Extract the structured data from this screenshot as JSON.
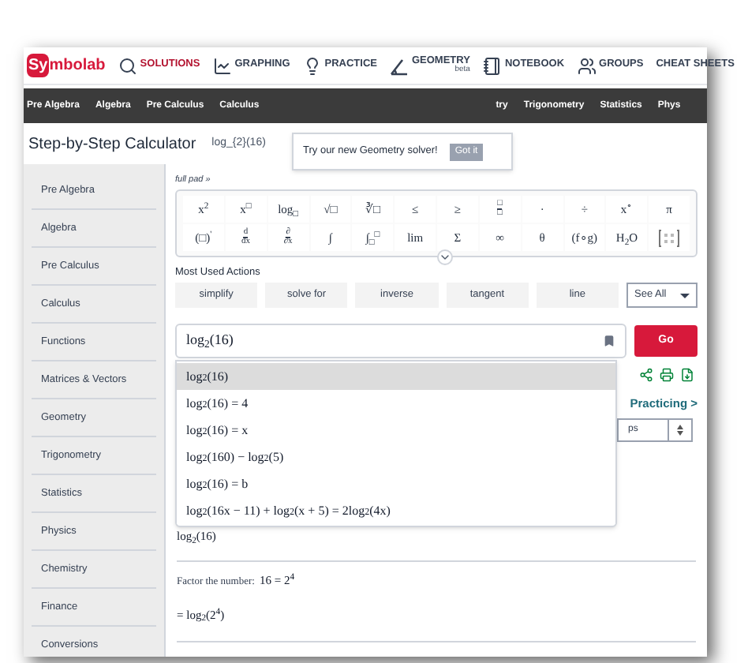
{
  "logo": {
    "accent": "Sy",
    "rest": "mbolab"
  },
  "nav": [
    {
      "label": "SOLUTIONS",
      "selected": true
    },
    {
      "label": "GRAPHING",
      "selected": false
    },
    {
      "label": "PRACTICE",
      "selected": false
    },
    {
      "label": "GEOMETRY",
      "sub": "beta",
      "selected": false
    },
    {
      "label": "NOTEBOOK",
      "selected": false
    },
    {
      "label": "GROUPS",
      "selected": false
    },
    {
      "label": "CHEAT SHEETS",
      "selected": false
    }
  ],
  "categories_left": [
    "Pre Algebra",
    "Algebra",
    "Pre Calculus",
    "Calculus"
  ],
  "categories_right": [
    "try",
    "Trigonometry",
    "Statistics",
    "Phys"
  ],
  "tooltip": {
    "text": "Try our new Geometry solver!",
    "button": "Got it"
  },
  "page_title": "Step-by-Step Calculator",
  "query": "log_{2}(16)",
  "sidebar": [
    "Pre Algebra",
    "Algebra",
    "Pre Calculus",
    "Calculus",
    "Functions",
    "Matrices & Vectors",
    "Geometry",
    "Trigonometry",
    "Statistics",
    "Physics",
    "Chemistry",
    "Finance",
    "Conversions"
  ],
  "pad_toggle": "full pad »",
  "keypad": [
    [
      {
        "kind": "text",
        "t": "x$^{2}$"
      },
      {
        "kind": "text",
        "t": "x$^{□}$"
      },
      {
        "kind": "text",
        "t": "log$_{□}$"
      },
      {
        "kind": "text",
        "t": "√□"
      },
      {
        "kind": "text",
        "t": "∛□"
      },
      {
        "kind": "text",
        "t": "≤"
      },
      {
        "kind": "text",
        "t": "≥"
      },
      {
        "kind": "fraction",
        "top": "□",
        "bottom": "□"
      },
      {
        "kind": "text",
        "t": "·"
      },
      {
        "kind": "text",
        "t": "÷"
      },
      {
        "kind": "text",
        "t": "x$^{∘}$"
      },
      {
        "kind": "text",
        "t": "π"
      }
    ],
    [
      {
        "kind": "text",
        "t": "(□)$^{'}$"
      },
      {
        "kind": "fraction",
        "top": "d",
        "bottom": "dx"
      },
      {
        "kind": "fraction",
        "top": "∂",
        "bottom": "∂x"
      },
      {
        "kind": "text",
        "t": "∫"
      },
      {
        "kind": "text",
        "t": "∫$_{□}$$^{□}$"
      },
      {
        "kind": "text",
        "t": "lim"
      },
      {
        "kind": "text",
        "t": "Σ"
      },
      {
        "kind": "text",
        "t": "∞"
      },
      {
        "kind": "text",
        "t": "θ"
      },
      {
        "kind": "text",
        "t": "(f∘g)"
      },
      {
        "kind": "text",
        "t": "H$_{2}$O"
      },
      {
        "kind": "matrix"
      }
    ]
  ],
  "actions_title": "Most Used Actions",
  "actions": [
    "simplify",
    "solve for",
    "inverse",
    "tangent",
    "line"
  ],
  "see_all": "See All",
  "input": {
    "value": "log$_{2}$(16)"
  },
  "go": "Go",
  "suggestions": [
    {
      "text": "log$_{2}$(16)",
      "selected": true
    },
    {
      "text": "log$_{2}$(16) = 4",
      "selected": false
    },
    {
      "text": "log$_{2}$(16) = x",
      "selected": false
    },
    {
      "text": "log$_{2}$(160) − log$_{2}$(5)",
      "selected": false
    },
    {
      "text": "log$_{2}$(16) = b",
      "selected": false
    },
    {
      "text": "log$_{2}$(16x − 11) + log$_{2}$(x + 5) = 2log$_{2}$(4x)",
      "selected": false
    }
  ],
  "practice_link": "Practicing >",
  "select_value": "ps",
  "steps": [
    {
      "kind": "math",
      "text": "log$_{2}$(16)"
    },
    {
      "kind": "label",
      "label": "Factor the number:",
      "text": "16 = 2$^{4}$"
    },
    {
      "kind": "math",
      "text": "= log$_{2}$(2$^{4}$)"
    }
  ]
}
